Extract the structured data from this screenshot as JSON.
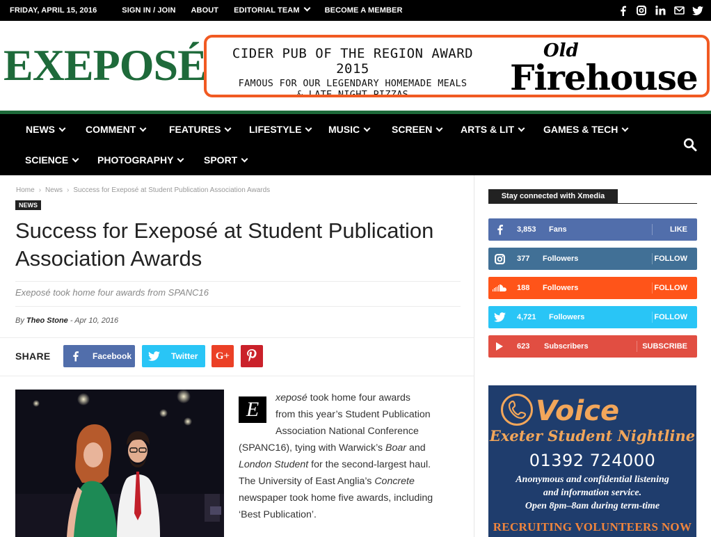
{
  "topbar": {
    "date": "FRIDAY, APRIL 15, 2016",
    "links": [
      "SIGN IN / JOIN",
      "ABOUT",
      "EDITORIAL TEAM",
      "BECOME A MEMBER"
    ],
    "social_icons": [
      "facebook-icon",
      "instagram-icon",
      "linkedin-icon",
      "mail-icon",
      "twitter-icon"
    ]
  },
  "header": {
    "logo": "Exeposé",
    "banner": {
      "line1": "CIDER PUB OF THE REGION AWARD 2015",
      "line2": "FAMOUS FOR OUR LEGENDARY HOMEMADE MEALS",
      "line3": "& LATE NIGHT PIZZAS",
      "brand_small": "Old",
      "brand_large": "Firehouse"
    }
  },
  "nav": {
    "row1": [
      "NEWS",
      "COMMENT",
      "FEATURES",
      "LIFESTYLE",
      "MUSIC",
      "SCREEN",
      "ARTS & LIT",
      "GAMES & TECH"
    ],
    "row2": [
      "SCIENCE",
      "PHOTOGRAPHY",
      "SPORT"
    ]
  },
  "article": {
    "breadcrumb": [
      "Home",
      "News",
      "Success for Exeposé at Student Publication Association Awards"
    ],
    "tag": "NEWS",
    "title": "Success for Exeposé at Student Publication Association Awards",
    "subtitle": "Exeposé took home four awards from SPANC16",
    "by": "By",
    "author": "Theo Stone",
    "date": "Apr 10, 2016",
    "share_label": "SHARE",
    "share_buttons": [
      "Facebook",
      "Twitter"
    ],
    "dropcap": "E",
    "body_lines": [
      [
        "xeposé",
        " took home four awards"
      ],
      [
        "from this year’s Student Publication"
      ],
      [
        "Association National Conference"
      ],
      [
        "(SPANC16), tying with Warwick’s ",
        "Boar",
        " and"
      ],
      [
        "London Student",
        " for the second-largest haul."
      ],
      [
        "The University of East Anglia’s ",
        "Concrete"
      ],
      [
        "newspaper took home five awards, including"
      ],
      [
        "‘Best Publication’."
      ]
    ]
  },
  "sidebar": {
    "heading": "Stay connected with Xmedia",
    "social": [
      {
        "icon": "facebook-icon",
        "count": "3,853",
        "label": "Fans",
        "action": "LIKE",
        "color": "#516eab"
      },
      {
        "icon": "instagram-icon",
        "count": "377",
        "label": "Followers",
        "action": "FOLLOW",
        "color": "#417096"
      },
      {
        "icon": "soundcloud-icon",
        "count": "188",
        "label": "Followers",
        "action": "FOLLOW",
        "color": "#ff5419"
      },
      {
        "icon": "twitter-icon",
        "count": "4,721",
        "label": "Followers",
        "action": "FOLLOW",
        "color": "#29c5f6"
      },
      {
        "icon": "youtube-icon",
        "count": "623",
        "label": "Subscribers",
        "action": "SUBSCRIBE",
        "color": "#e14e42"
      }
    ],
    "ad": {
      "brand": "Voice",
      "tagline": "Exeter Student Nightline",
      "phone": "01392 724000",
      "info1": "Anonymous and confidential listening",
      "info2": "and information service.",
      "info3": "Open 8pm–8am during term-time",
      "recruit": "RECRUITING VOLUNTEERS NOW"
    }
  }
}
